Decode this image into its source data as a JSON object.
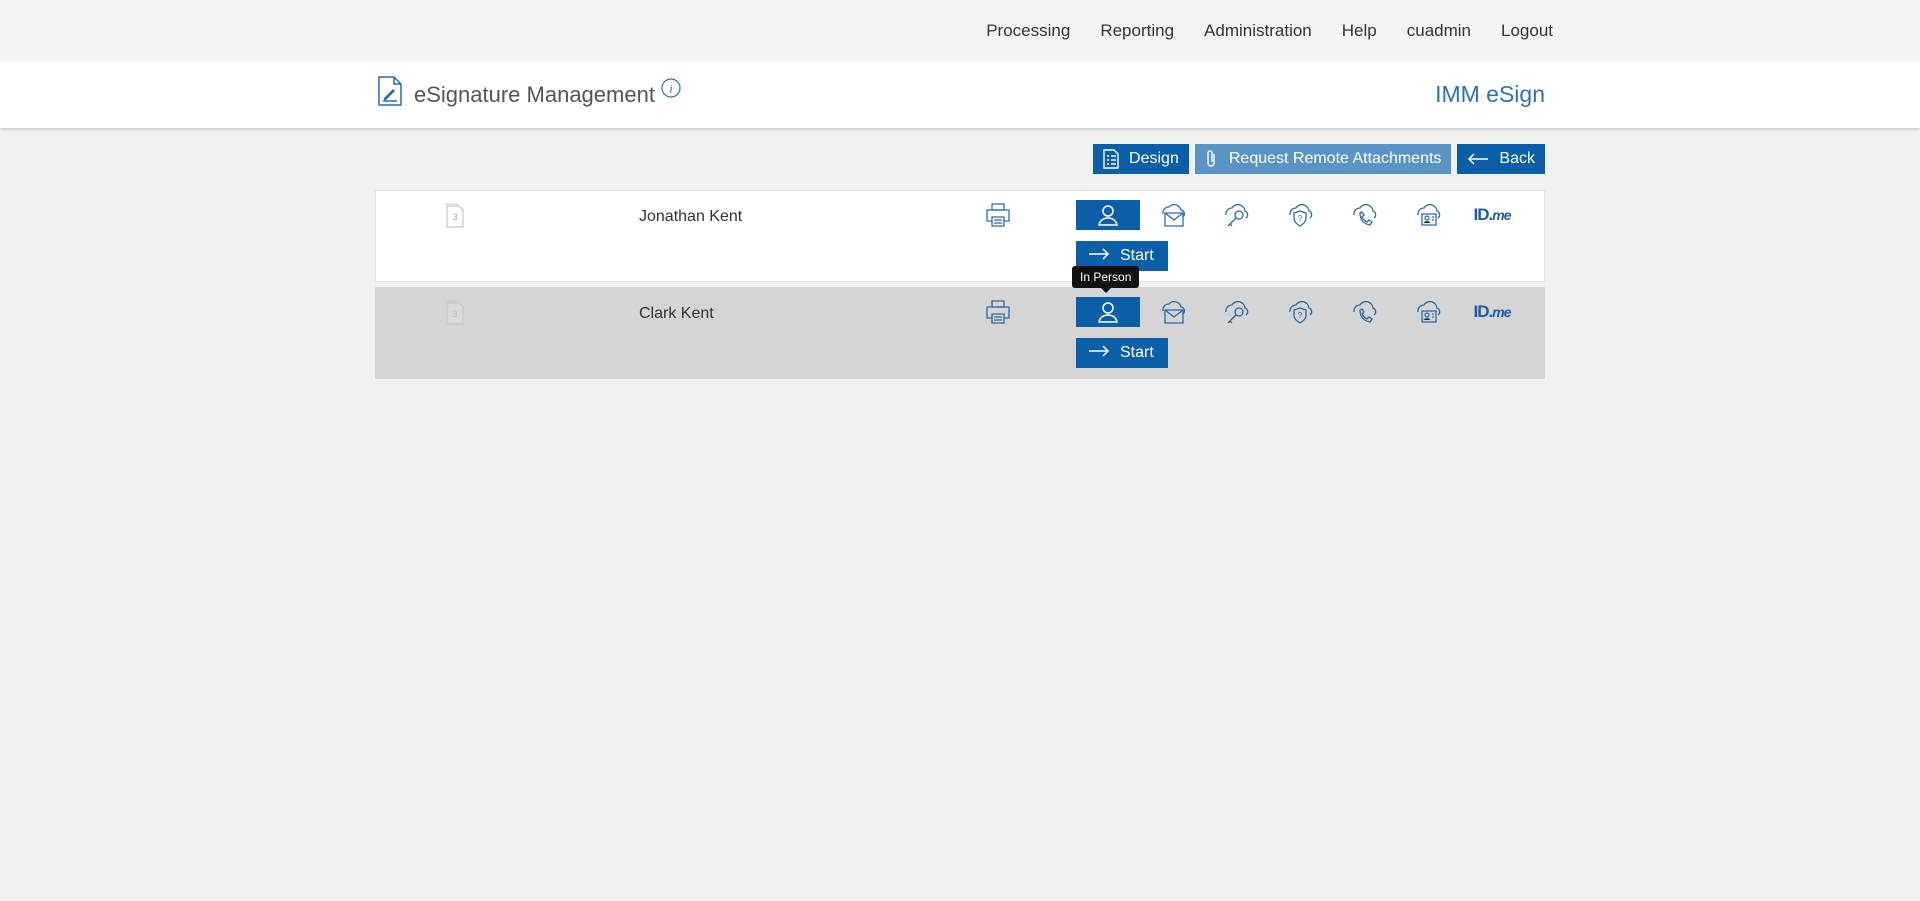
{
  "nav": {
    "items": [
      "Processing",
      "Reporting",
      "Administration",
      "Help",
      "cuadmin",
      "Logout"
    ]
  },
  "header": {
    "title": "eSignature Management",
    "brand": "IMM eSign",
    "app_icon": "document-sign-icon",
    "info_icon": "info-icon"
  },
  "toolbar": {
    "design_label": "Design",
    "attachments_label": "Request Remote Attachments",
    "back_label": "Back"
  },
  "colors": {
    "primary": "#0b5fa8",
    "primary_light": "#5a93c6",
    "brand_text": "#2d73b4",
    "row_alt": "#d5d5d5"
  },
  "signers": [
    {
      "doc_count": "3",
      "name": "Jonathan Kent",
      "start_label": "Start"
    },
    {
      "doc_count": "3",
      "name": "Clark Kent",
      "start_label": "Start"
    }
  ],
  "methods": {
    "idme_main": "ID.",
    "idme_suffix": "me",
    "icons": [
      "in-person-icon",
      "email-cloud-icon",
      "key-cloud-icon",
      "question-cloud-icon",
      "phone-cloud-icon",
      "id-card-cloud-icon",
      "idme-logo"
    ]
  },
  "tooltip": {
    "text": "In Person"
  }
}
